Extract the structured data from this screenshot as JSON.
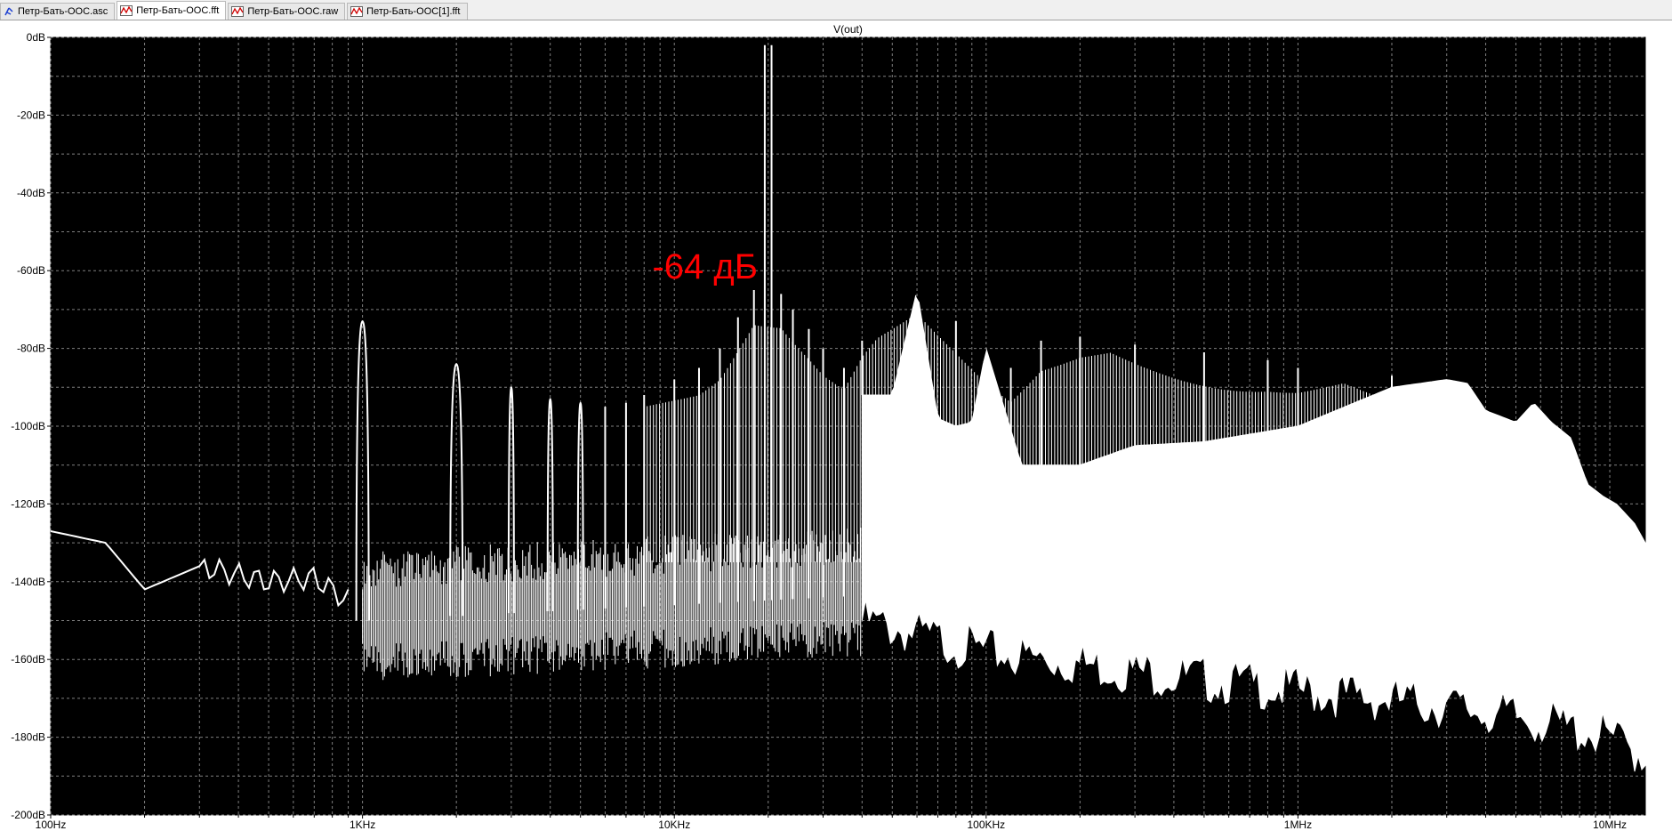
{
  "tabs": [
    {
      "label": "Петр-Бать-ООС.asc",
      "icon": "schematic-icon",
      "active": false
    },
    {
      "label": "Петр-Бать-ООС.fft",
      "icon": "waveform-icon",
      "active": true
    },
    {
      "label": "Петр-Бать-ООС.raw",
      "icon": "waveform-icon",
      "active": false
    },
    {
      "label": "Петр-Бать-ООС[1].fft",
      "icon": "waveform-icon",
      "active": false
    }
  ],
  "colors": {
    "plot_bg": "#000000",
    "trace": "#ffffff",
    "grid": "#7f7f7f",
    "annotation": "#ff0000",
    "frame_bg": "#ffffff"
  },
  "chart_data": {
    "type": "line",
    "title": "V(out)",
    "x_scale": "log",
    "xlim_hz": [
      100,
      13000000
    ],
    "ylim_db": [
      -200,
      0
    ],
    "grid": true,
    "x_ticks": [
      {
        "value": 100,
        "label": "100Hz"
      },
      {
        "value": 1000,
        "label": "1KHz"
      },
      {
        "value": 10000,
        "label": "10KHz"
      },
      {
        "value": 100000,
        "label": "100KHz"
      },
      {
        "value": 1000000,
        "label": "1MHz"
      },
      {
        "value": 10000000,
        "label": "10MHz"
      }
    ],
    "y_ticks": [
      {
        "value": 0,
        "label": "0dB"
      },
      {
        "value": -20,
        "label": "-20dB"
      },
      {
        "value": -40,
        "label": "-40dB"
      },
      {
        "value": -60,
        "label": "-60dB"
      },
      {
        "value": -80,
        "label": "-80dB"
      },
      {
        "value": -100,
        "label": "-100dB"
      },
      {
        "value": -120,
        "label": "-120dB"
      },
      {
        "value": -140,
        "label": "-140dB"
      },
      {
        "value": -160,
        "label": "-160dB"
      },
      {
        "value": -180,
        "label": "-180dB"
      },
      {
        "value": -200,
        "label": "-200dB"
      }
    ],
    "noise_floor": [
      [
        100,
        -127
      ],
      [
        150,
        -130
      ],
      [
        200,
        -142
      ],
      [
        300,
        -136
      ],
      [
        500,
        -140
      ],
      [
        700,
        -139
      ],
      [
        900,
        -145
      ]
    ],
    "peaks": [
      [
        1000,
        -73
      ],
      [
        2000,
        -84
      ],
      [
        3000,
        -90
      ],
      [
        4000,
        -93
      ],
      [
        5000,
        -94
      ],
      [
        6000,
        -95
      ],
      [
        7000,
        -94
      ],
      [
        8000,
        -92
      ],
      [
        10000,
        -88
      ],
      [
        12000,
        -85
      ],
      [
        14000,
        -80
      ],
      [
        16000,
        -72
      ],
      [
        18000,
        -65
      ],
      [
        19500,
        -2
      ],
      [
        20500,
        -2
      ],
      [
        22000,
        -66
      ],
      [
        24000,
        -70
      ],
      [
        27000,
        -75
      ],
      [
        30000,
        -80
      ],
      [
        35000,
        -85
      ],
      [
        40000,
        -78
      ],
      [
        60000,
        -65
      ],
      [
        80000,
        -73
      ],
      [
        100000,
        -80
      ],
      [
        120000,
        -85
      ],
      [
        150000,
        -78
      ],
      [
        200000,
        -77
      ],
      [
        300000,
        -79
      ],
      [
        500000,
        -81
      ],
      [
        800000,
        -83
      ],
      [
        1000000,
        -85
      ],
      [
        2000000,
        -87
      ],
      [
        3000000,
        -88
      ]
    ],
    "upper_envelope": [
      [
        40000,
        -92
      ],
      [
        50000,
        -92
      ],
      [
        60000,
        -65
      ],
      [
        70000,
        -98
      ],
      [
        80000,
        -100
      ],
      [
        90000,
        -99
      ],
      [
        100000,
        -80
      ],
      [
        130000,
        -110
      ],
      [
        200000,
        -110
      ],
      [
        300000,
        -105
      ],
      [
        500000,
        -104
      ],
      [
        1000000,
        -100
      ],
      [
        2000000,
        -90
      ],
      [
        3000000,
        -88
      ],
      [
        3500000,
        -89
      ],
      [
        4000000,
        -96
      ],
      [
        5000000,
        -99
      ],
      [
        5700000,
        -94
      ],
      [
        6500000,
        -99
      ],
      [
        7500000,
        -103
      ],
      [
        8500000,
        -115
      ],
      [
        9500000,
        -118
      ],
      [
        10500000,
        -120
      ],
      [
        12000000,
        -125
      ],
      [
        13000000,
        -130
      ]
    ],
    "lower_envelope": [
      [
        40000,
        -150
      ],
      [
        100000,
        -158
      ],
      [
        300000,
        -163
      ],
      [
        1000000,
        -168
      ],
      [
        3000000,
        -172
      ],
      [
        6000000,
        -176
      ],
      [
        10000000,
        -180
      ],
      [
        13000000,
        -185
      ]
    ],
    "annotations": [
      {
        "text": "-64 дБ",
        "x_hz": 8500,
        "y_db": -62
      }
    ]
  }
}
